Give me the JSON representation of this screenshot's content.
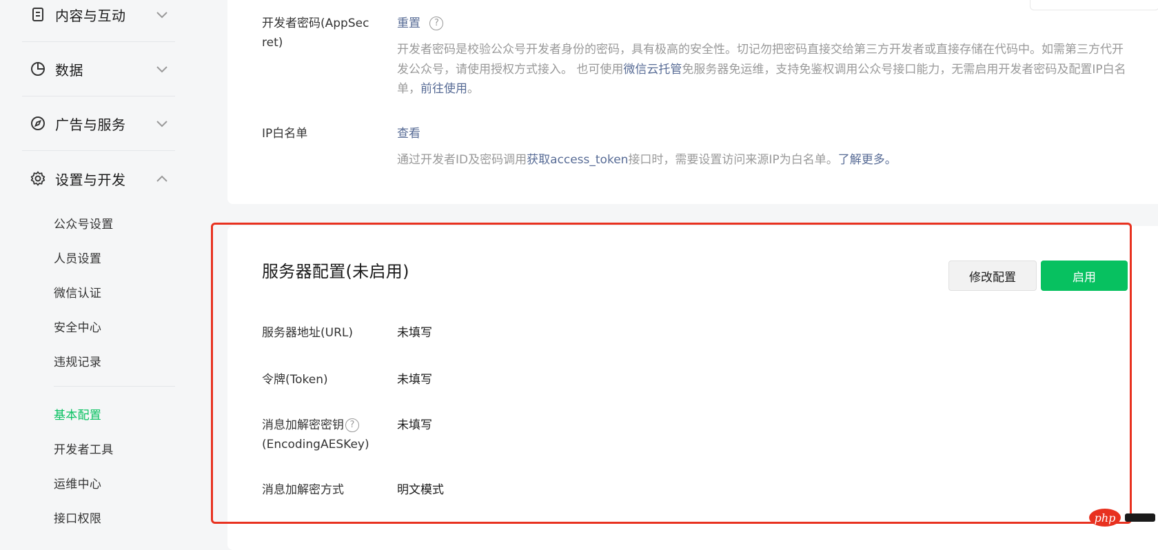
{
  "sidebar": {
    "groups": [
      {
        "label": "内容与互动",
        "icon": "document-icon",
        "expanded": false
      },
      {
        "label": "数据",
        "icon": "pie-chart-icon",
        "expanded": false
      },
      {
        "label": "广告与服务",
        "icon": "compass-icon",
        "expanded": false
      },
      {
        "label": "设置与开发",
        "icon": "gear-icon",
        "expanded": true
      }
    ],
    "sub_items": [
      "公众号设置",
      "人员设置",
      "微信认证",
      "安全中心",
      "违规记录"
    ],
    "sub_items_dev": [
      "基本配置",
      "开发者工具",
      "运维中心",
      "接口权限"
    ],
    "active_item": "基本配置"
  },
  "developer_card": {
    "appsecret": {
      "label_line1": "开发者密码(AppSec",
      "label_line2": "ret)",
      "action": "重置",
      "help": "?",
      "desc_1": "开发者密码是校验公众号开发者身份的密码，具有极高的安全性。切记勿把密码直接交给第三方开发者或直接存储在代码中。如需第三方代开发公众号，请使用授权方式接入。 也可使用",
      "desc_link1": "微信云托管",
      "desc_2": "免服务器免运维，支持免鉴权调用公众号接口能力，无需启用开发者密码及配置IP白名单，",
      "desc_link2": "前往使用",
      "desc_3": "。"
    },
    "ip_whitelist": {
      "label": "IP白名单",
      "action": "查看",
      "desc_1": "通过开发者ID及密码调用",
      "desc_link1": "获取access_token",
      "desc_2": "接口时，需要设置访问来源IP为白名单。",
      "desc_link2": "了解更多。"
    }
  },
  "server_card": {
    "title": "服务器配置(未启用)",
    "modify_button": "修改配置",
    "enable_button": "启用",
    "rows": [
      {
        "label": "服务器地址(URL)",
        "value": "未填写"
      },
      {
        "label": "令牌(Token)",
        "value": "未填写"
      },
      {
        "label_line1": "消息加解密密钥",
        "label_line2": "(EncodingAESKey)",
        "value": "未填写",
        "help": "?"
      },
      {
        "label": "消息加解密方式",
        "value": "明文模式"
      }
    ]
  },
  "watermark": {
    "text": "php"
  },
  "colors": {
    "accent_green": "#07c160",
    "link_blue": "#576b95",
    "highlight_red": "#e8311f",
    "muted_text": "#999999"
  }
}
